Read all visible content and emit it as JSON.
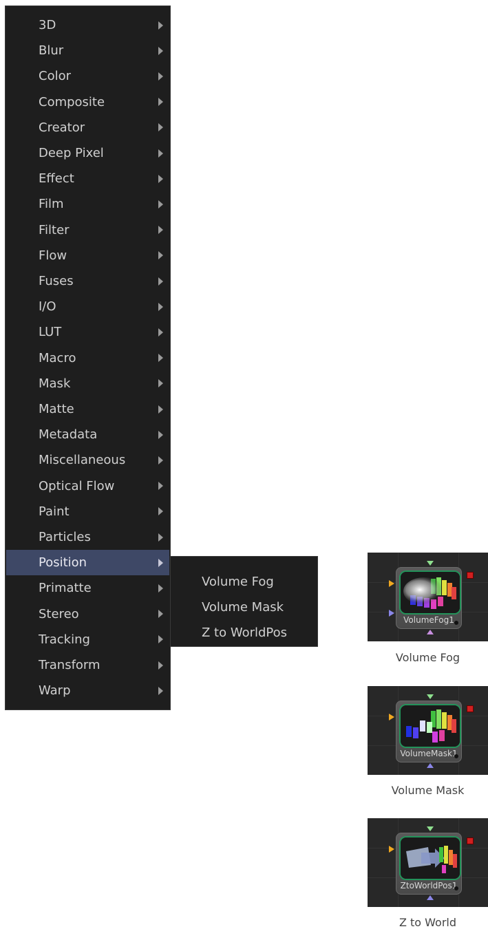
{
  "menu": {
    "items": [
      {
        "label": "3D"
      },
      {
        "label": "Blur"
      },
      {
        "label": "Color"
      },
      {
        "label": "Composite"
      },
      {
        "label": "Creator"
      },
      {
        "label": "Deep Pixel"
      },
      {
        "label": "Effect"
      },
      {
        "label": "Film"
      },
      {
        "label": "Filter"
      },
      {
        "label": "Flow"
      },
      {
        "label": "Fuses"
      },
      {
        "label": "I/O"
      },
      {
        "label": "LUT"
      },
      {
        "label": "Macro"
      },
      {
        "label": "Mask"
      },
      {
        "label": "Matte"
      },
      {
        "label": "Metadata"
      },
      {
        "label": "Miscellaneous"
      },
      {
        "label": "Optical Flow"
      },
      {
        "label": "Paint"
      },
      {
        "label": "Particles"
      },
      {
        "label": "Position",
        "active": true
      },
      {
        "label": "Primatte"
      },
      {
        "label": "Stereo"
      },
      {
        "label": "Tracking"
      },
      {
        "label": "Transform"
      },
      {
        "label": "Warp"
      }
    ]
  },
  "submenu": {
    "items": [
      {
        "label": "Volume Fog"
      },
      {
        "label": "Volume Mask"
      },
      {
        "label": "Z to WorldPos"
      }
    ]
  },
  "nodes": [
    {
      "name": "VolumeFog1",
      "caption": "Volume Fog",
      "icon": "volume-fog-node-icon"
    },
    {
      "name": "VolumeMask1",
      "caption": "Volume Mask",
      "icon": "volume-mask-node-icon"
    },
    {
      "name": "ZtoWorldPos1",
      "caption": "Z to World",
      "icon": "z-to-worldpos-node-icon"
    }
  ],
  "colors": {
    "menu_bg": "#1e1e1e",
    "active_bg": "#3e4866",
    "menu_text": "#d0d0d0",
    "node_border": "#23935a"
  }
}
